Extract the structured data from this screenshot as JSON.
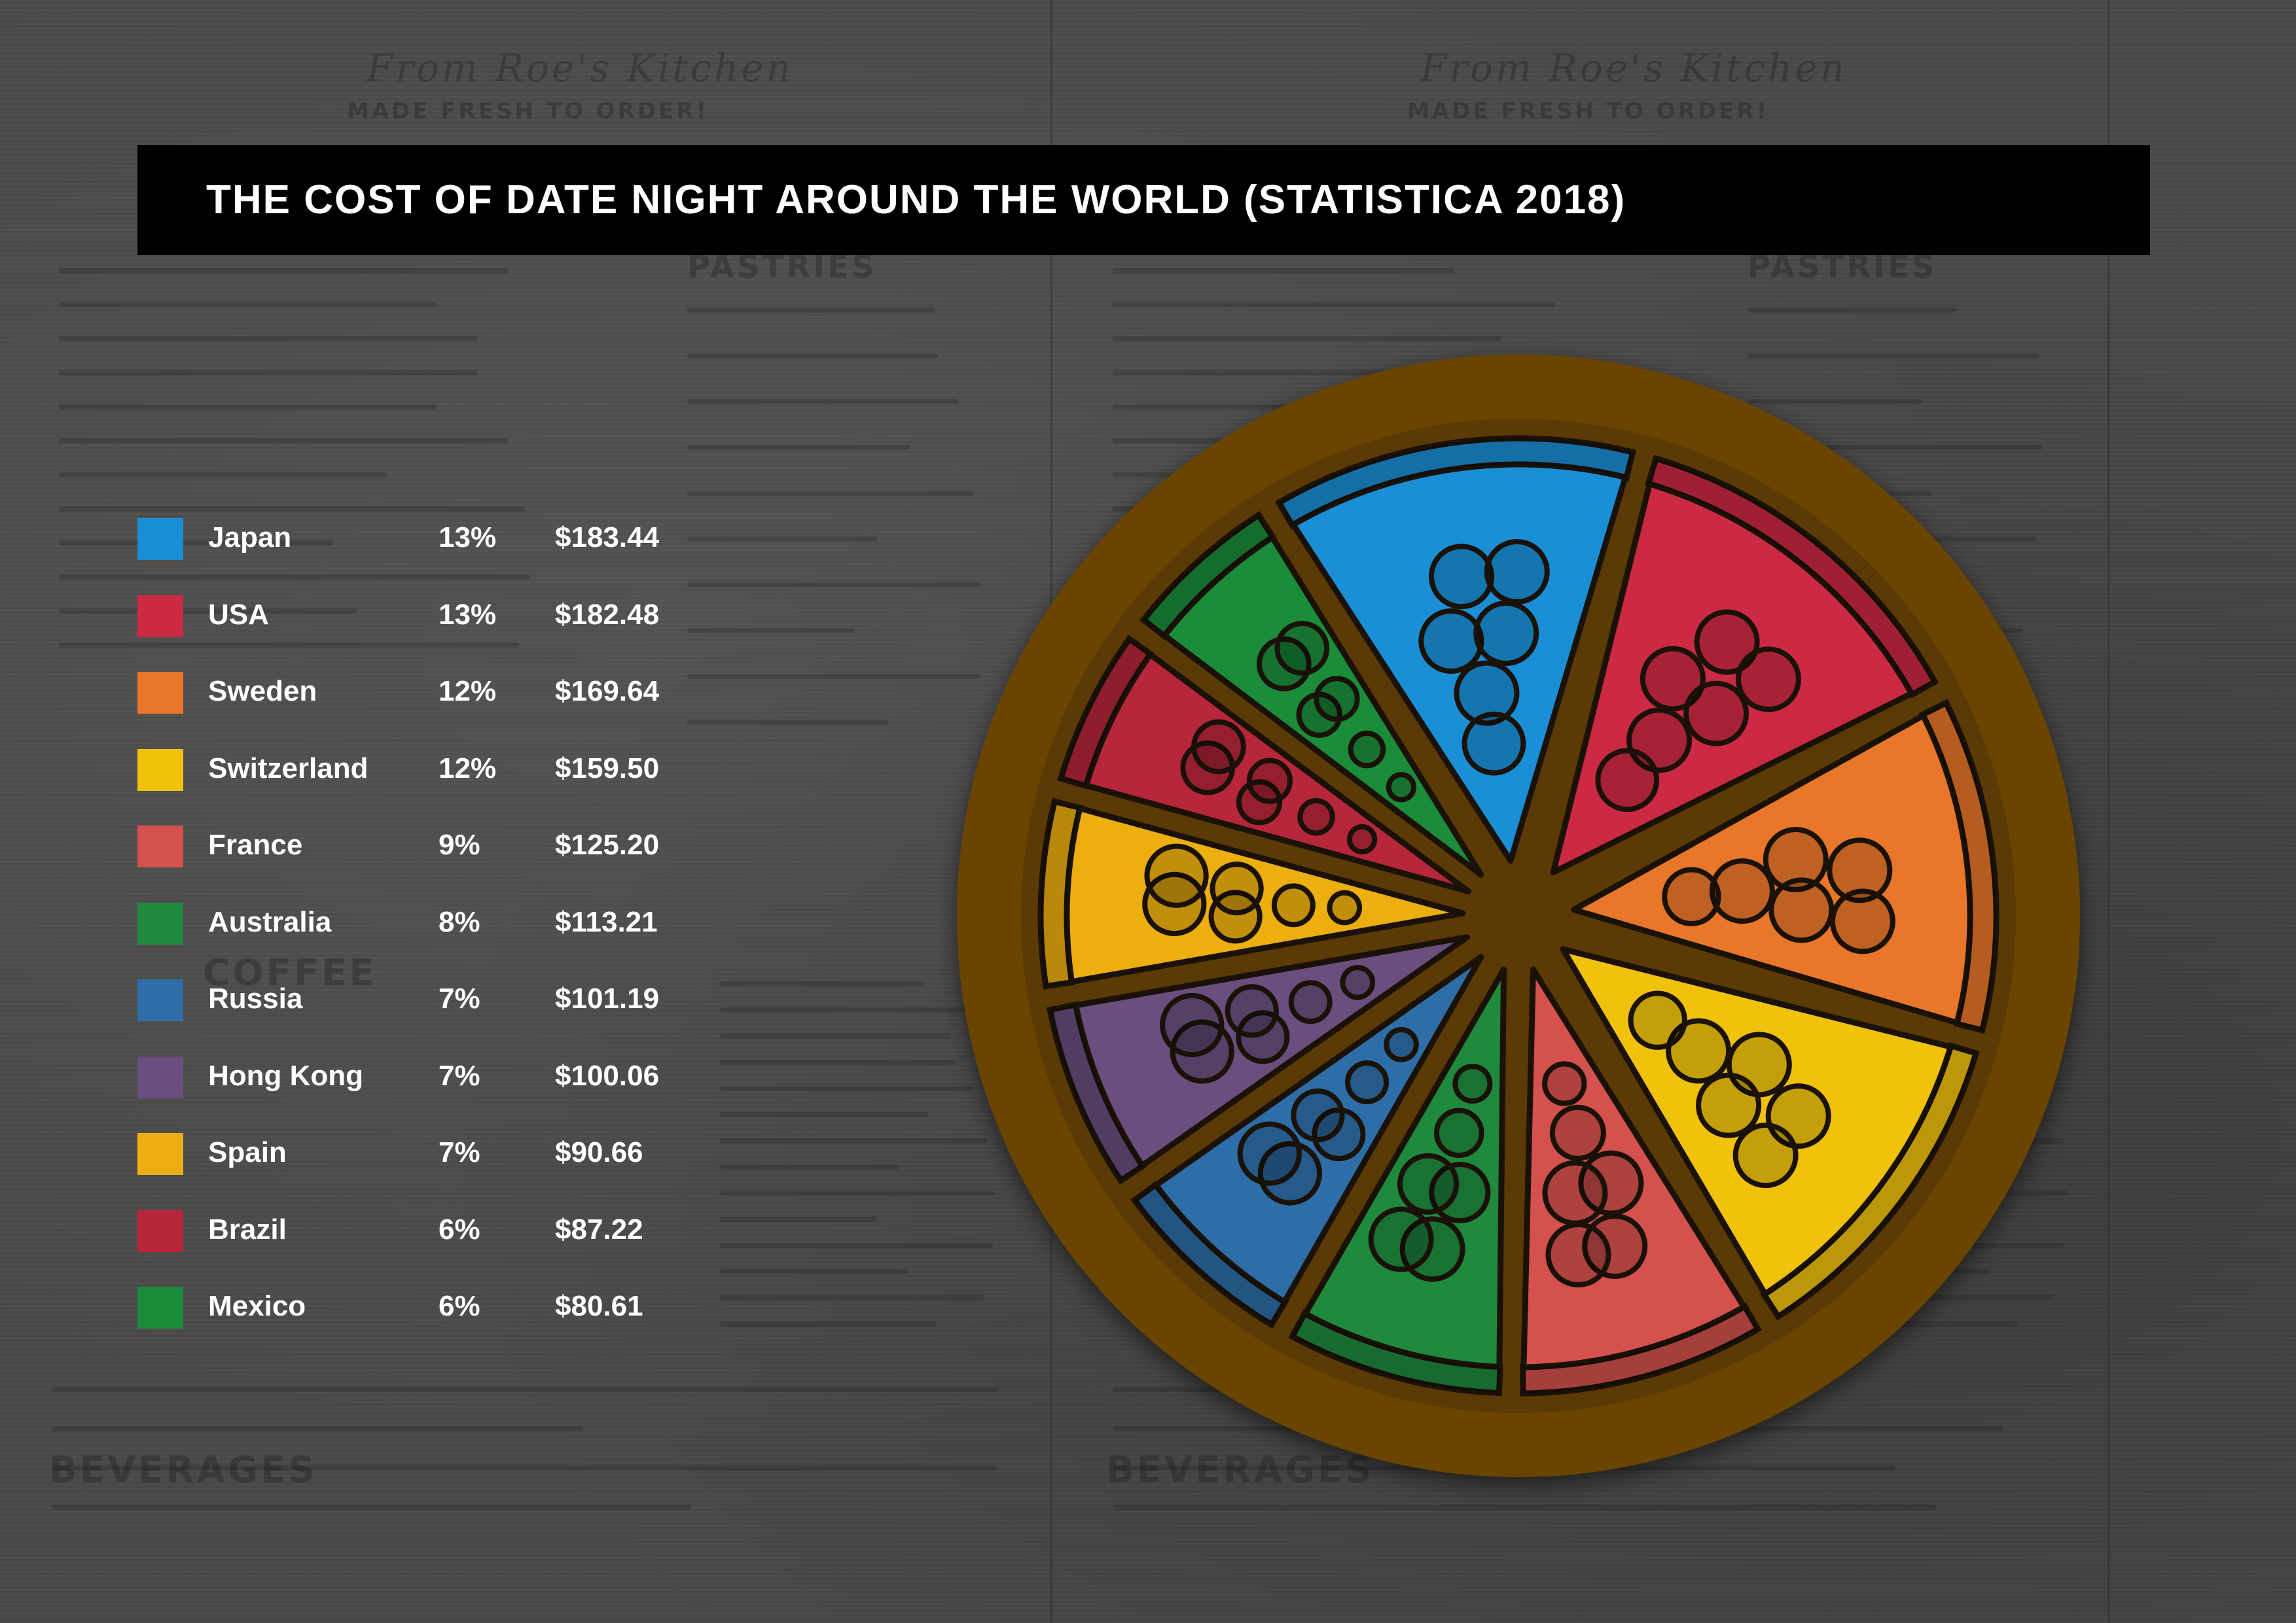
{
  "title": "THE COST OF DATE NIGHT AROUND THE WORLD (STATISTICA 2018)",
  "background_words": [
    "From Roe's Kitchen",
    "MADE FRESH TO ORDER!",
    "PASTRIES",
    "COFFEE",
    "BEVERAGES"
  ],
  "colors": {
    "plate_outer": "#6b4506",
    "plate_inner": "#5c3a05",
    "title_bar": "#000000",
    "crust_outline": "#1a1208"
  },
  "chart_data": {
    "type": "pie",
    "title": "THE COST OF DATE NIGHT AROUND THE WORLD (STATISTICA 2018)",
    "legend_position": "left",
    "slices": [
      {
        "label": "Japan",
        "percent": "13%",
        "value": 13,
        "cost": "$183.44",
        "color": "#1a8fd6"
      },
      {
        "label": "USA",
        "percent": "13%",
        "value": 13,
        "cost": "$182.48",
        "color": "#cc2a44"
      },
      {
        "label": "Sweden",
        "percent": "12%",
        "value": 12,
        "cost": "$169.64",
        "color": "#e8772a"
      },
      {
        "label": "Switzerland",
        "percent": "12%",
        "value": 12,
        "cost": "$159.50",
        "color": "#f0c20c"
      },
      {
        "label": "France",
        "percent": "9%",
        "value": 9,
        "cost": "$125.20",
        "color": "#d4514e"
      },
      {
        "label": "Australia",
        "percent": "8%",
        "value": 8,
        "cost": "$113.21",
        "color": "#1f8a3e"
      },
      {
        "label": "Russia",
        "percent": "7%",
        "value": 7,
        "cost": "$101.19",
        "color": "#2e6ea8"
      },
      {
        "label": "Hong Kong",
        "percent": "7%",
        "value": 7,
        "cost": "$100.06",
        "color": "#6a4f7e"
      },
      {
        "label": "Spain",
        "percent": "7%",
        "value": 7,
        "cost": "$90.66",
        "color": "#ecaf0f"
      },
      {
        "label": "Brazil",
        "percent": "6%",
        "value": 6,
        "cost": "$87.22",
        "color": "#b7263a"
      },
      {
        "label": "Mexico",
        "percent": "6%",
        "value": 6,
        "cost": "$80.61",
        "color": "#1a8c3a"
      }
    ]
  }
}
